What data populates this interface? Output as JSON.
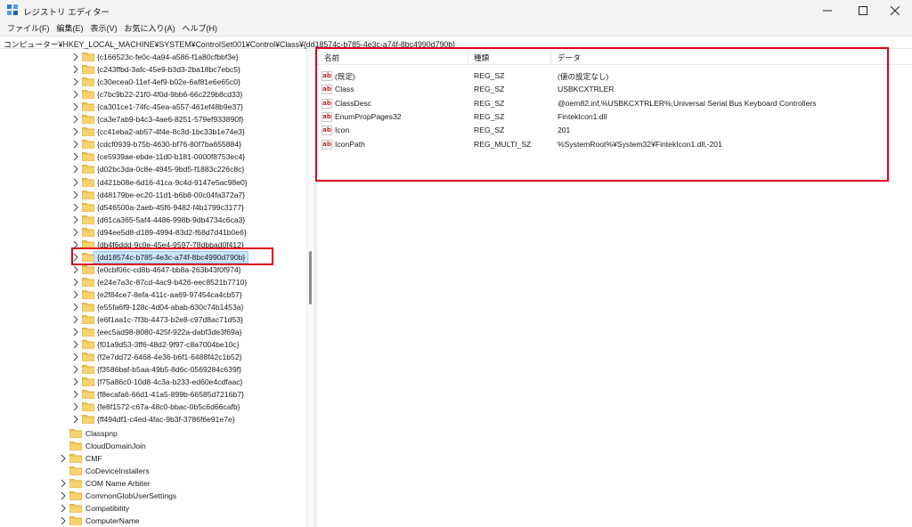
{
  "window": {
    "title": "レジストリ エディター"
  },
  "menu": [
    "ファイル(F)",
    "編集(E)",
    "表示(V)",
    "お気に入り(A)",
    "ヘルプ(H)"
  ],
  "address": "コンピューター¥HKEY_LOCAL_MACHINE¥SYSTEM¥ControlSet001¥Control¥Class¥{dd18574c-b785-4e3c-a74f-8bc4990d790b}",
  "tree": {
    "class_keys": [
      "{c166523c-fe0c-4a94-a586-f1a80cfbbf3e}",
      "{c243ffbd-3afc-45e9-b3d3-2ba18bc7ebc5}",
      "{c30ecea0-11ef-4ef9-b02e-6af81e6e65c0}",
      "{c7bc9b22-21f0-4f0d-9bb6-66c229b8cd33}",
      "{ca301ce1-74fc-45ea-a557-461ef48b9e37}",
      "{ca3e7ab9-b4c3-4ae6-8251-579ef933890f}",
      "{cc41eba2-ab57-4f4e-8c3d-1bc33b1e74e3}",
      "{cdcf0939-b75b-4630-bf76-80f7ba655884}",
      "{ce5939ae-ebde-11d0-b181-0000f8753ec4}",
      "{d02bc3da-0c8e-4945-9bd5-f1883c226c8c}",
      "{d421b08e-6d16-41ca-9c4d-9147e5ac98e0}",
      "{d48179be-ec20-11d1-b6b8-00c04fa372a7}",
      "{d546500a-2aeb-45f6-9482-f4b1799c3177}",
      "{d61ca365-5af4-4486-998b-9db4734c6ca3}",
      "{d94ee5d8-d189-4994-83d2-f68d7d41b0e6}",
      "{db4f6ddd-9c0e-45e4-9597-78dbbad0f412}",
      "{dd18574c-b785-4e3c-a74f-8bc4990d790b}",
      "{e0cbf06c-cd8b-4647-bb8a-263b43f0f974}",
      "{e24e7a3c-87cd-4ac9-b426-eec8521b7710}",
      "{e2f84ce7-8efa-411c-aa69-97454ca4cb57}",
      "{e55fa6f9-128c-4d04-abab-630c74b1453a}",
      "{e6f1aa1c-7f3b-4473-b2e8-c97d8ac71d53}",
      "{eec5ad98-8080-425f-922a-dabf3de3f69a}",
      "{f01a9d53-3ff6-48d2-9f97-c8a7004be10c}",
      "{f2e7dd72-6468-4e36-b6f1-6488f42c1b52}",
      "{f3586baf-b5aa-49b5-8d6c-0569284c639f}",
      "{f75a86c0-10d8-4c3a-b233-ed60e4cdfaac}",
      "{f8ecafa6-66d1-41a5-899b-66585d7216b7}",
      "{fe8f1572-c67a-48c0-bbac-0b5c6d66cafb}",
      "{ff494df1-c4ed-4fac-9b3f-3786f6e91e7e}"
    ],
    "selected_index": 16,
    "control_keys": [
      {
        "label": "Classpnp",
        "expandable": false
      },
      {
        "label": "CloudDomainJoin",
        "expandable": false
      },
      {
        "label": "CMF",
        "expandable": true
      },
      {
        "label": "CoDeviceInstallers",
        "expandable": false
      },
      {
        "label": "COM Name Arbiter",
        "expandable": true
      },
      {
        "label": "CommonGlobUserSettings",
        "expandable": true
      },
      {
        "label": "Compatibility",
        "expandable": true
      },
      {
        "label": "ComputerName",
        "expandable": true
      }
    ]
  },
  "list": {
    "columns": [
      "名前",
      "種類",
      "データ"
    ],
    "rows": [
      {
        "name": "(既定)",
        "type": "REG_SZ",
        "data": "(値の設定なし)",
        "icon": "string-value-icon"
      },
      {
        "name": "Class",
        "type": "REG_SZ",
        "data": "USBKCXTRLER",
        "icon": "string-value-icon"
      },
      {
        "name": "ClassDesc",
        "type": "REG_SZ",
        "data": "@oem82.inf,%USBKCXTRLER%;Universal Serial Bus Keyboard Controllers",
        "icon": "string-value-icon"
      },
      {
        "name": "EnumPropPages32",
        "type": "REG_SZ",
        "data": "FintekIcon1.dll",
        "icon": "string-value-icon"
      },
      {
        "name": "Icon",
        "type": "REG_SZ",
        "data": "201",
        "icon": "string-value-icon"
      },
      {
        "name": "IconPath",
        "type": "REG_MULTI_SZ",
        "data": "%SystemRoot%¥System32¥FintekIcon1.dll,-201",
        "icon": "string-value-icon"
      }
    ]
  },
  "colors": {
    "highlight_red": "#e0001b",
    "folder": "#f3c150",
    "selection": "#cce4f7"
  }
}
